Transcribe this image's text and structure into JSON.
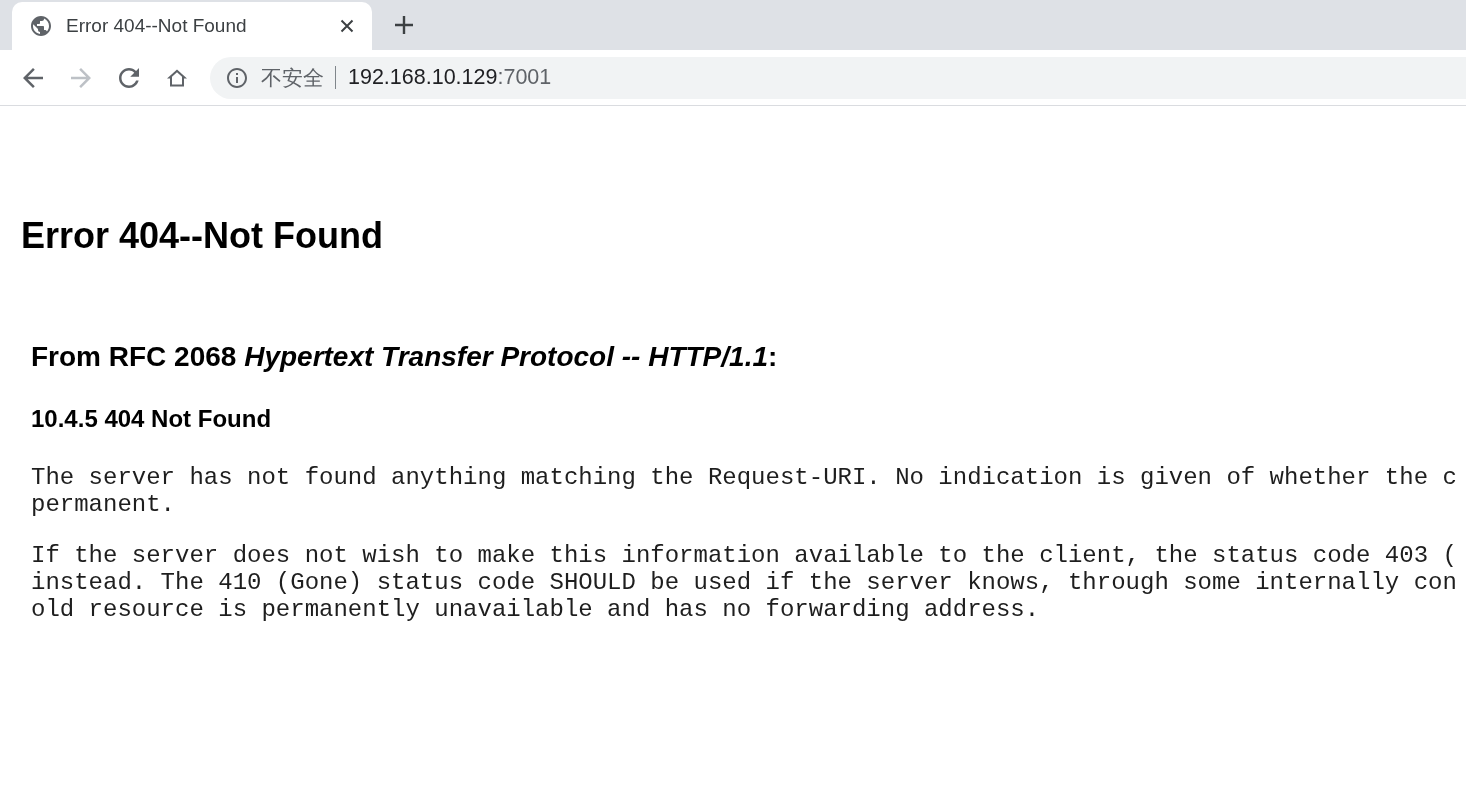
{
  "browser": {
    "tabs": [
      {
        "title": "Error 404--Not Found",
        "selected": true
      }
    ],
    "nav_buttons": [
      {
        "kind": "back",
        "disabled": false
      },
      {
        "kind": "forward",
        "disabled": true
      },
      {
        "kind": "reload",
        "disabled": false
      },
      {
        "kind": "home",
        "disabled": false
      }
    ],
    "address_bar": {
      "security_label": "不安全",
      "host": "192.168.10.129",
      "port": ":7001"
    }
  },
  "page": {
    "heading": "Error 404--Not Found",
    "source": "From RFC 2068 *Hypertext Transfer Protocol -- HTTP/1.1*:",
    "section": "10.4.5 404 Not Found",
    "paragraphs": [
      {
        "lines": [
          "The server has not found anything matching the Request-URI. No indication is given of whether the c",
          "permanent."
        ]
      },
      {
        "lines": [
          "If the server does not wish to make this information available to the client, the status code 403 (",
          "instead. The 410 (Gone) status code SHOULD be used if the server knows, through some internally con",
          "old resource is permanently unavailable and has no forwarding address."
        ]
      }
    ]
  }
}
